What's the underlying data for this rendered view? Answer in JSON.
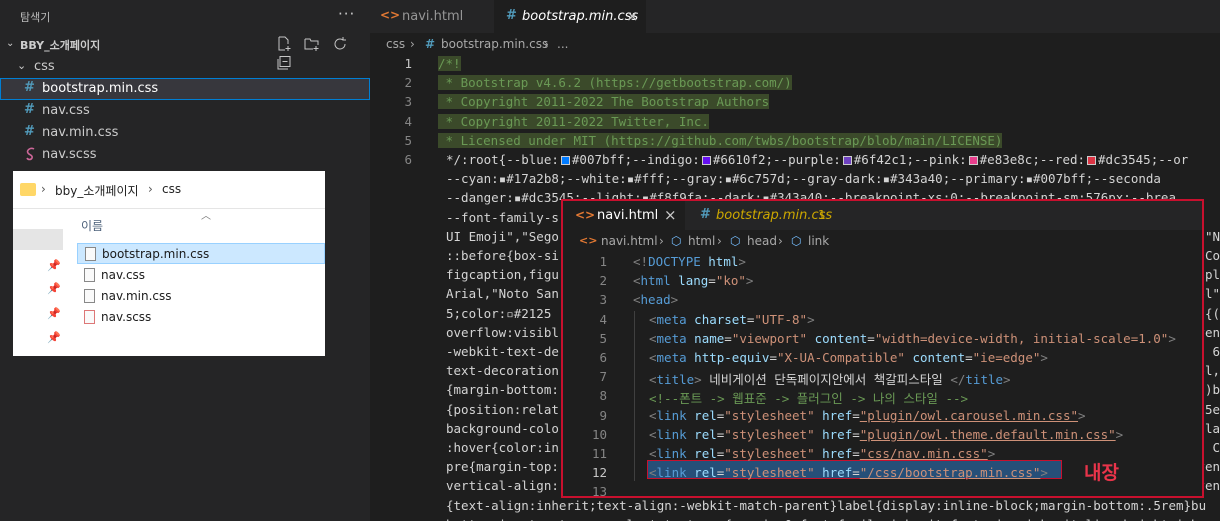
{
  "sidebar": {
    "title": "탐색기",
    "more": "···",
    "folder_name": "BBY_소개페이지",
    "subfolder": "css",
    "files": [
      {
        "label": "bootstrap.min.css",
        "icon": "#",
        "selected": true
      },
      {
        "label": "nav.css",
        "icon": "#"
      },
      {
        "label": "nav.min.css",
        "icon": "#"
      },
      {
        "label": "nav.scss",
        "icon": "sass-icon"
      }
    ]
  },
  "tabs": [
    {
      "label": "navi.html",
      "active": false
    },
    {
      "label": "bootstrap.min.css",
      "active": true
    }
  ],
  "close_symbol": "×",
  "breadcrumb": {
    "part1": "css",
    "sep": "›",
    "file": "bootstrap.min.css",
    "more": "..."
  },
  "editor": {
    "line_numbers": [
      "1",
      "2",
      "3",
      "4",
      "5",
      "6"
    ],
    "lines": [
      "/*!",
      " * Bootstrap v4.6.2 (https://getbootstrap.com/)",
      " * Copyright 2011-2022 The Bootstrap Authors",
      " * Copyright 2011-2022 Twitter, Inc.",
      " * Licensed under MIT (https://github.com/twbs/bootstrap/blob/main/LICENSE)"
    ],
    "line6": {
      "prefix": "*/:root{--blue:",
      "items": [
        {
          "color": "#007bff",
          "text": "#007bff;--indigo:"
        },
        {
          "color": "#6610f2",
          "text": "#6610f2;--purple:"
        },
        {
          "color": "#6f42c1",
          "text": "#6f42c1;--pink:"
        },
        {
          "color": "#e83e8c",
          "text": "#e83e8c;--red:"
        },
        {
          "color": "#dc3545",
          "text": "#dc3545;--or"
        }
      ]
    },
    "wrap_lines": [
      "--cyan:▪#17a2b8;--white:▪#fff;--gray:▪#6c757d;--gray-dark:▪#343a40;--primary:▪#007bff;--seconda",
      "--danger:▪#dc3545;--light:▪#f8f9fa;--dark:▪#343a40;--breakpoint-xs:0;--breakpoint-sm:576px;--brea",
      "--font-family-s",
      "UI Emoji\",\"Sego",
      "::before{box-si",
      "figcaption,figu",
      "Arial,\"Noto San",
      "5;color:▫#2125",
      "overflow:visibl",
      "-webkit-text-de",
      "text-decoration",
      "{margin-bottom:",
      "{position:relat",
      "background-colo",
      ":hover{color:in",
      "pre{margin-top:",
      "vertical-align:",
      "{text-align:inherit;text-align:-webkit-match-parent}label{display:inline-block;margin-bottom:.5rem}bu",
      "button,input,optgroup,select,textarea{margin:0;font-family:inherit;font-size:inherit;line-height:inh"
    ],
    "right_edge": [
      "\"N",
      "Co",
      "opl",
      "ol\"",
      "{(",
      "ven",
      "6",
      "ol,",
      ")b",
      "5e",
      "la",
      "C",
      "ven",
      "ven"
    ]
  },
  "explorer": {
    "path": [
      "bby_소개페이지",
      "css"
    ],
    "column_header": "이름",
    "files": [
      {
        "label": "bootstrap.min.css",
        "selected": true
      },
      {
        "label": "nav.css"
      },
      {
        "label": "nav.min.css"
      },
      {
        "label": "nav.scss"
      }
    ]
  },
  "popup": {
    "tabs": [
      {
        "label": "navi.html",
        "active": true,
        "close": "×"
      },
      {
        "label": "bootstrap.min.css",
        "badge": "1",
        "active": false
      }
    ],
    "breadcrumb": [
      "navi.html",
      "html",
      "head",
      "link"
    ],
    "line_numbers": [
      "1",
      "2",
      "3",
      "4",
      "5",
      "6",
      "7",
      "8",
      "9",
      "10",
      "11",
      "12",
      "13"
    ],
    "title_text": "네비게이션 단독페이지안에서 책갈피스타일",
    "comment_text": "<!--폰트 -> 웹표준 -> 플러그인 -> 나의 스타일 -->",
    "annotation": "내장"
  }
}
